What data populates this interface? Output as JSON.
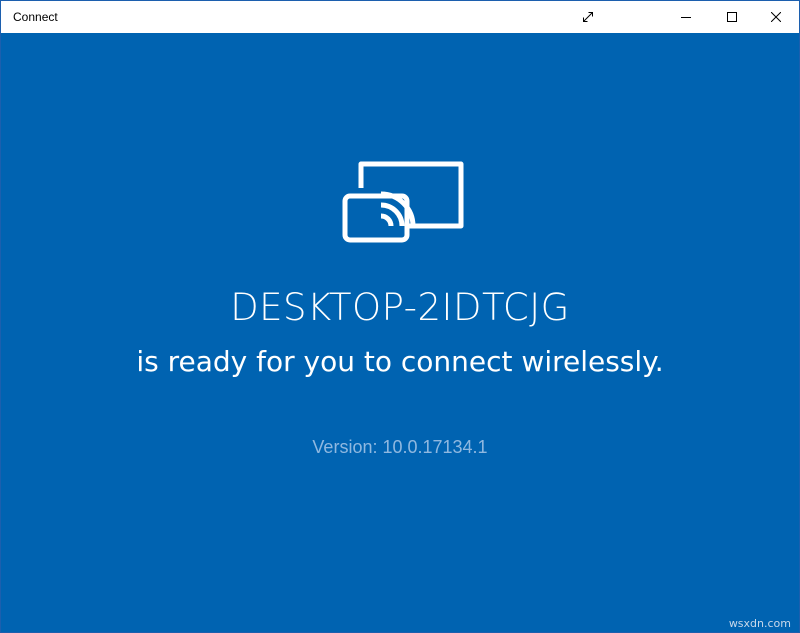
{
  "window": {
    "title": "Connect",
    "controls": {
      "expand_icon": "expand-arrows-icon",
      "minimize_icon": "minimize-icon",
      "maximize_icon": "maximize-icon",
      "close_icon": "close-icon"
    }
  },
  "main": {
    "icon": "wireless-cast-icon",
    "device_name": "DESKTOP-2IDTCJG",
    "ready_message": "is ready for you to connect wirelessly.",
    "version": "Version: 10.0.17134.1"
  },
  "watermark": "wsxdn.com",
  "colors": {
    "background": "#0063b1",
    "text": "#ffffff",
    "version_text": "#8fb8e0",
    "titlebar": "#ffffff"
  }
}
